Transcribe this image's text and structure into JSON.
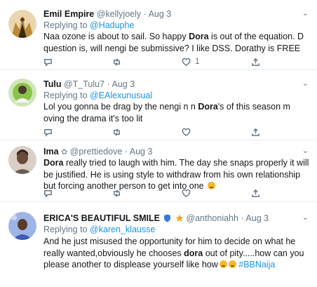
{
  "tweets": [
    {
      "name": "Emil Empire",
      "handle": "@kellyjoely",
      "dot": "·",
      "date": "Aug 3",
      "replying_prefix": "Replying to ",
      "replying_to": "@Haduphe",
      "text_a": "Naa ozone is about to sail. So happy ",
      "text_bold": "Dora",
      "text_b": " is out of the equation. D question is, will nengi be submissive? I like DSS. Dorathy is FREE",
      "like_count": "1",
      "avatar_color": "#b98a3a"
    },
    {
      "name": "Tulu",
      "handle": "@T_Tulu7",
      "dot": "·",
      "date": "Aug 3",
      "replying_prefix": "Replying to ",
      "replying_to": "@EAlexunusual",
      "text_a": "Lol you gonna be drag by the nengi n n ",
      "text_bold": "Dora",
      "text_b": "'s of this season m oving the drama it's too lit",
      "avatar_color": "#8bc34a"
    },
    {
      "name": "Ima",
      "handle": "@prettiedove",
      "dot": "·",
      "date": "Aug 3",
      "text_bold": "Dora",
      "text_b": " really tried to laugh with him. The day she snaps properly it will be justified. He is using style to withdraw from his own relationship but forcing another person to get into one",
      "avatar_color": "#6b5e57"
    },
    {
      "name": "ERICA'S BEAUTIFUL SMILE",
      "handle": "@anthoniahh",
      "dot": "·",
      "date": "Aug 3",
      "replying_prefix": "Replying to ",
      "replying_to": "@karen_klausse",
      "text_a": "And he just misused the opportunity for him to decide on what he really wanted,obviously he chooses ",
      "text_bold": "dora",
      "text_b": " out of pity.....how can you please another to displease yourself like how",
      "hashtag": "#BBNaija",
      "avatar_color": "#3b5bb5"
    }
  ],
  "colors": {
    "link": "#1b95e0",
    "secondary": "#657786",
    "border": "#e6ecf0"
  },
  "icons": [
    "reply-icon",
    "retweet-icon",
    "like-icon",
    "share-icon",
    "chevron-down-icon"
  ]
}
